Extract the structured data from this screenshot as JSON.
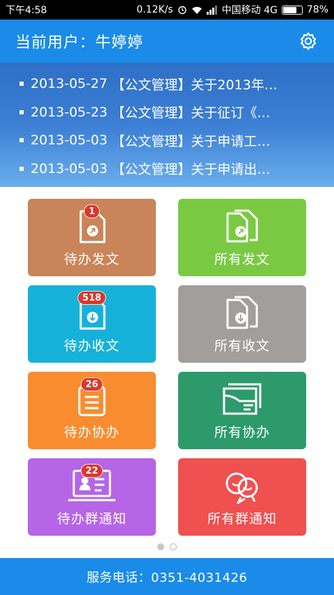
{
  "status_bar": {
    "time": "下午4:58",
    "network_speed": "0.12K/s",
    "carrier": "中国移动 4G",
    "battery": "78%",
    "battery_level": 0.78
  },
  "header": {
    "title": "当前用户：牛婷婷",
    "settings_icon": "gear-icon"
  },
  "news": [
    {
      "date": "2013-05-27",
      "title": "【公文管理】关于2013年…"
    },
    {
      "date": "2013-05-23",
      "title": "【公文管理】关于征订《…"
    },
    {
      "date": "2013-05-03",
      "title": "【公文管理】关于申请工…"
    },
    {
      "date": "2013-05-03",
      "title": "【公文管理】关于申请出…"
    }
  ],
  "tiles": [
    {
      "label": "待办发文",
      "badge": "1",
      "color": "#c98459",
      "icon": "pending-send-doc-icon"
    },
    {
      "label": "所有发文",
      "badge": "",
      "color": "#7ac943",
      "icon": "all-send-doc-icon"
    },
    {
      "label": "待办收文",
      "badge": "518",
      "color": "#16b1d9",
      "icon": "pending-receive-doc-icon"
    },
    {
      "label": "所有收文",
      "badge": "",
      "color": "#a19e9b",
      "icon": "all-receive-doc-icon"
    },
    {
      "label": "待办协办",
      "badge": "26",
      "color": "#f88c2f",
      "icon": "pending-assist-icon"
    },
    {
      "label": "所有协办",
      "badge": "",
      "color": "#2c9a6b",
      "icon": "all-assist-icon"
    },
    {
      "label": "待办群通知",
      "badge": "22",
      "color": "#b565e6",
      "icon": "pending-group-notice-icon"
    },
    {
      "label": "所有群通知",
      "badge": "",
      "color": "#ef5050",
      "icon": "all-group-notice-icon"
    }
  ],
  "pager": {
    "pages": 2,
    "active": 1
  },
  "footer": {
    "text": "服务电话：0351-4031426"
  }
}
